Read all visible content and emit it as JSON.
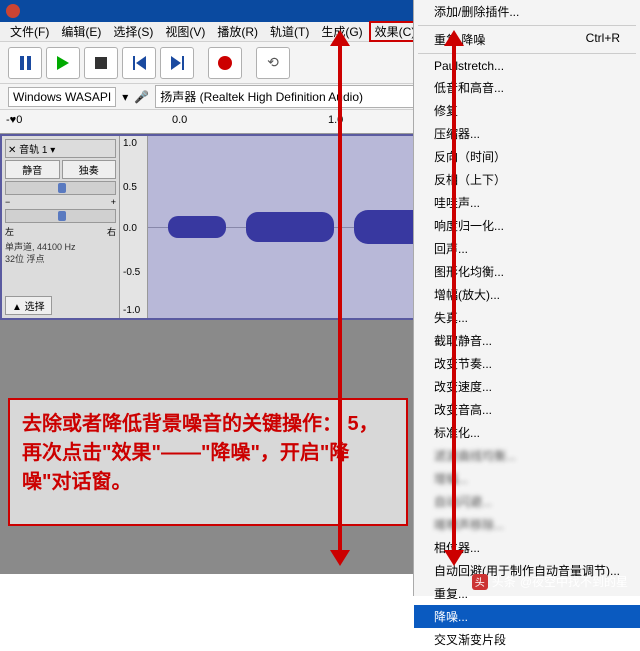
{
  "menubar": {
    "file": "文件(F)",
    "edit": "编辑(E)",
    "select": "选择(S)",
    "view": "视图(V)",
    "transport": "播放(R)",
    "tracks": "轨道(T)",
    "generate": "生成(G)",
    "effect": "效果(C)"
  },
  "device": {
    "host": "Windows WASAPI",
    "output_label": "扬声器 (Realtek High Definition Audio)"
  },
  "ruler": {
    "neg": "-♥0",
    "zero": "0.0",
    "one": "1.0"
  },
  "track": {
    "mute": "静音",
    "solo": "独奏",
    "minus": "−",
    "plus": "+",
    "left": "左",
    "right": "右",
    "info1": "单声道, 44100 Hz",
    "info2": "32位 浮点",
    "collapse": "▲  选择",
    "scale": {
      "p1": "1.0",
      "p05": "0.5",
      "z": "0.0",
      "m05": "-0.5",
      "m1": "-1.0"
    },
    "header": "✕ 音轨 1 ▾"
  },
  "annotation": {
    "text": "去除或者降低背景噪音的关键操作：\n5，再次点击\"效果\"——\"降噪\"，开启\"降噪\"对话窗。"
  },
  "dropdown": {
    "add_remove": "添加/删除插件...",
    "repeat_noise": "重复 降噪",
    "repeat_sc": "Ctrl+R",
    "paulstretch": "Paulstretch...",
    "bass_treble": "低音和高音...",
    "repair": "修复",
    "compressor": "压缩器...",
    "reverse": "反向（时间）",
    "invert": "反相（上下）",
    "wahwah": "哇哇声...",
    "normalize": "响度归一化...",
    "echo": "回声...",
    "graphic_eq": "图形化均衡...",
    "amplify_zoom": "增幅(放大)...",
    "distortion": "失真...",
    "truncate_silence": "截取静音...",
    "change_rhythm": "改变节奏...",
    "change_speed": "改变速度...",
    "change_pitch": "改变音高...",
    "normalize2": "标准化...",
    "filter_curve": "滤波曲线均衡...",
    "amplify": "增幅...",
    "auto_duck": "自动闪避...",
    "click_removal": "喀嚓声移除...",
    "phaser": "相位器...",
    "auto_echo": "自动回避(用于制作自动音量调节)...",
    "repeat": "重复...",
    "noise_reduction": "降噪...",
    "crossfade": "交叉渐变片段"
  },
  "watermark": {
    "brand": "头条",
    "author": "@夜空中找不到的星"
  }
}
